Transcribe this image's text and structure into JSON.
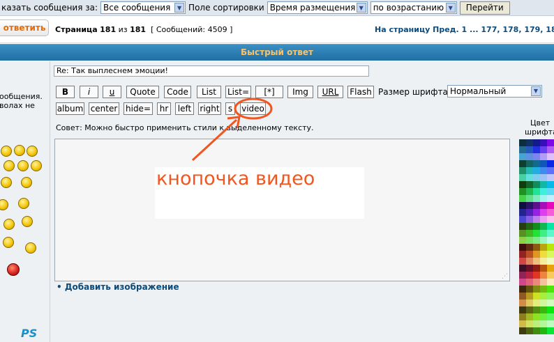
{
  "topbar": {
    "show_label": "казать сообщения за:",
    "show_value": "Все сообщения",
    "sort_label": "Поле сортировки",
    "sort_value": "Время размещения",
    "order_value": "по возрастанию",
    "go_label": "Перейти"
  },
  "pagination": {
    "reply_label": "ответить",
    "page_word": "Страница",
    "current": "181",
    "of_word": "из",
    "total": "181",
    "messages": "[ Сообщений: 4509 ]",
    "nav": "На страницу Пред.  1 ... 177, 178, 179, 180, 1"
  },
  "quick_reply": {
    "title": "Быстрый ответ"
  },
  "leftpanel": {
    "line1": "ообщения.",
    "line2": "волах не",
    "bottom_logo": "PS"
  },
  "form": {
    "subject": "Re: Так выплеснем эмоции!",
    "font_size_label": "Размер шрифта:",
    "font_size_value": "Нормальный",
    "tip": "Совет: Можно быстро применить стили к выделенному тексту.",
    "add_image": "• Добавить изображение",
    "color_label_1": "Цвет",
    "color_label_2": "шрифта"
  },
  "toolbar_row1": [
    "B",
    "i",
    "u",
    "Quote",
    "Code",
    "List",
    "List=",
    "[*]",
    "Img",
    "URL",
    "Flash"
  ],
  "toolbar_row2": [
    "album",
    "center",
    "hide=",
    "hr",
    "left",
    "right",
    "s",
    "video"
  ],
  "annotation": {
    "text": "кнопочка видео",
    "color": "#f2551e"
  },
  "colors": {
    "header": "#2a7fb5",
    "header_text": "#f8c36b",
    "link": "#0b4a7a",
    "reply": "#e26b0a"
  },
  "icons": [
    "dropdown-caret-icon",
    "smiley-icon",
    "arrow-icon"
  ]
}
